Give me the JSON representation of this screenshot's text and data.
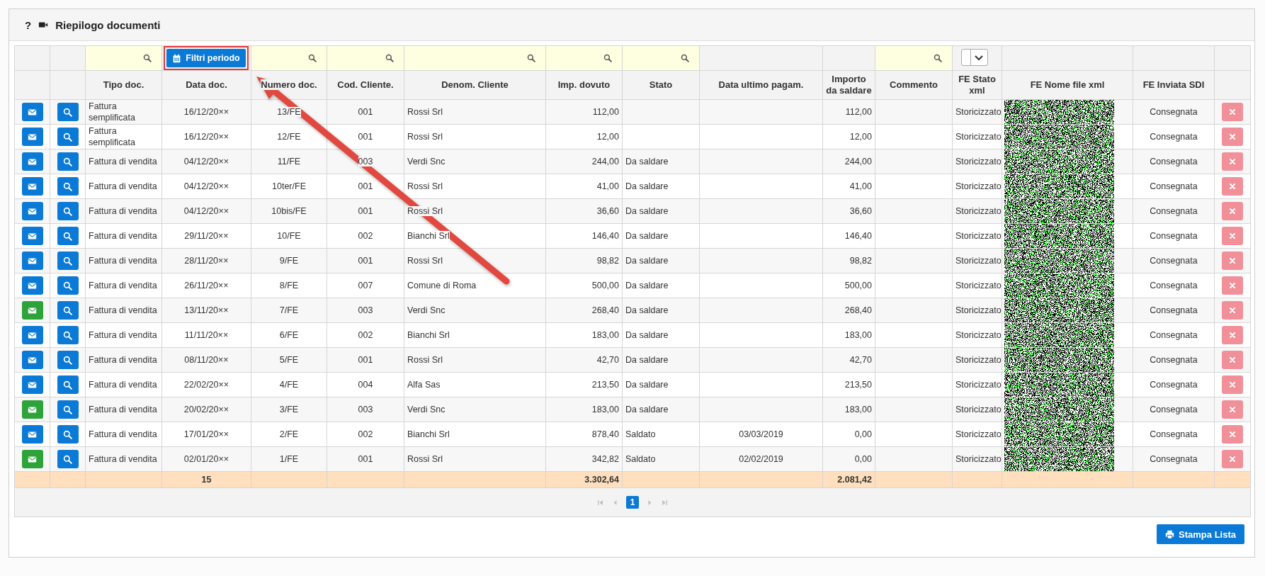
{
  "panel": {
    "help": "?",
    "title": "Riepilogo documenti"
  },
  "columns": [
    {
      "label": "Tipo doc.",
      "kind": "search"
    },
    {
      "label": "Data doc.",
      "kind": "period",
      "button": "Filtri periodo"
    },
    {
      "label": "Numero doc.",
      "kind": "search"
    },
    {
      "label": "Cod. Cliente.",
      "kind": "search"
    },
    {
      "label": "Denom. Cliente",
      "kind": "search"
    },
    {
      "label": "Imp. dovuto",
      "kind": "search"
    },
    {
      "label": "Stato",
      "kind": "search"
    },
    {
      "label": "Data ultimo pagam.",
      "kind": "plain"
    },
    {
      "label": "Importo da saldare",
      "kind": "plain"
    },
    {
      "label": "Commento",
      "kind": "search"
    },
    {
      "label": "FE Stato xml",
      "kind": "select"
    },
    {
      "label": "FE Nome file xml",
      "kind": "plain"
    },
    {
      "label": "FE Inviata SDI",
      "kind": "plain"
    }
  ],
  "rows": [
    {
      "mail_button": {
        "color": "#0b7ad6"
      },
      "type": "Fattura semplificata",
      "date": "16/12/20××",
      "number": "13/FE",
      "customer_code": "001",
      "customer": "Rossi Srl",
      "amount_due": "112,00",
      "balance": "112,00",
      "fe_status": "Storicizzato",
      "fe_sent": "Consegnata"
    },
    {
      "mail_button": {
        "color": "#0b7ad6"
      },
      "type": "Fattura semplificata",
      "date": "16/12/20××",
      "number": "12/FE",
      "customer_code": "001",
      "customer": "Rossi Srl",
      "amount_due": "12,00",
      "balance": "12,00",
      "fe_status": "Storicizzato",
      "fe_sent": "Consegnata"
    },
    {
      "mail_button": {
        "color": "#0b7ad6"
      },
      "type": "Fattura di vendita",
      "date": "04/12/20××",
      "number": "11/FE",
      "customer_code": "003",
      "customer": "Verdi Snc",
      "amount_due": "244,00",
      "status": "Da saldare",
      "balance": "244,00",
      "fe_status": "Storicizzato",
      "fe_sent": "Consegnata"
    },
    {
      "mail_button": {
        "color": "#0b7ad6"
      },
      "type": "Fattura di vendita",
      "date": "04/12/20××",
      "number": "10ter/FE",
      "customer_code": "001",
      "customer": "Rossi Srl",
      "amount_due": "41,00",
      "status": "Da saldare",
      "balance": "41,00",
      "fe_status": "Storicizzato",
      "fe_sent": "Consegnata"
    },
    {
      "mail_button": {
        "color": "#0b7ad6"
      },
      "type": "Fattura di vendita",
      "date": "04/12/20××",
      "number": "10bis/FE",
      "customer_code": "001",
      "customer": "Rossi Srl",
      "amount_due": "36,60",
      "status": "Da saldare",
      "balance": "36,60",
      "fe_status": "Storicizzato",
      "fe_sent": "Consegnata"
    },
    {
      "mail_button": {
        "color": "#0b7ad6"
      },
      "type": "Fattura di vendita",
      "date": "29/11/20××",
      "number": "10/FE",
      "customer_code": "002",
      "customer": "Bianchi Srl",
      "amount_due": "146,40",
      "status": "Da saldare",
      "balance": "146,40",
      "fe_status": "Storicizzato",
      "fe_sent": "Consegnata"
    },
    {
      "mail_button": {
        "color": "#0b7ad6"
      },
      "type": "Fattura di vendita",
      "date": "28/11/20××",
      "number": "9/FE",
      "customer_code": "001",
      "customer": "Rossi Srl",
      "amount_due": "98,82",
      "status": "Da saldare",
      "balance": "98,82",
      "fe_status": "Storicizzato",
      "fe_sent": "Consegnata"
    },
    {
      "mail_button": {
        "color": "#0b7ad6"
      },
      "type": "Fattura di vendita",
      "date": "26/11/20××",
      "number": "8/FE",
      "customer_code": "007",
      "customer": "Comune di Roma",
      "amount_due": "500,00",
      "status": "Da saldare",
      "balance": "500,00",
      "fe_status": "Storicizzato",
      "fe_sent": "Consegnata"
    },
    {
      "mail_button": {
        "color": "#2ea33a"
      },
      "type": "Fattura di vendita",
      "date": "13/11/20××",
      "number": "7/FE",
      "customer_code": "003",
      "customer": "Verdi Snc",
      "amount_due": "268,40",
      "status": "Da saldare",
      "balance": "268,40",
      "fe_status": "Storicizzato",
      "fe_sent": "Consegnata"
    },
    {
      "mail_button": {
        "color": "#0b7ad6"
      },
      "type": "Fattura di vendita",
      "date": "11/11/20××",
      "number": "6/FE",
      "customer_code": "002",
      "customer": "Bianchi Srl",
      "amount_due": "183,00",
      "status": "Da saldare",
      "balance": "183,00",
      "fe_status": "Storicizzato",
      "fe_sent": "Consegnata"
    },
    {
      "mail_button": {
        "color": "#0b7ad6"
      },
      "type": "Fattura di vendita",
      "date": "08/11/20××",
      "number": "5/FE",
      "customer_code": "001",
      "customer": "Rossi Srl",
      "amount_due": "42,70",
      "status": "Da saldare",
      "balance": "42,70",
      "fe_status": "Storicizzato",
      "fe_sent": "Consegnata"
    },
    {
      "mail_button": {
        "color": "#0b7ad6"
      },
      "type": "Fattura di vendita",
      "date": "22/02/20××",
      "number": "4/FE",
      "customer_code": "004",
      "customer": "Alfa Sas",
      "amount_due": "213,50",
      "status": "Da saldare",
      "balance": "213,50",
      "fe_status": "Storicizzato",
      "fe_sent": "Consegnata"
    },
    {
      "mail_button": {
        "color": "#2ea33a"
      },
      "type": "Fattura di vendita",
      "date": "20/02/20××",
      "number": "3/FE",
      "customer_code": "003",
      "customer": "Verdi Snc",
      "amount_due": "183,00",
      "status": "Da saldare",
      "balance": "183,00",
      "fe_status": "Storicizzato",
      "fe_sent": "Consegnata"
    },
    {
      "mail_button": {
        "color": "#0b7ad6"
      },
      "type": "Fattura di vendita",
      "date": "17/01/20××",
      "number": "2/FE",
      "customer_code": "002",
      "customer": "Bianchi Srl",
      "amount_due": "878,40",
      "status": "Saldato",
      "last_payment": "03/03/2019",
      "balance": "0,00",
      "fe_status": "Storicizzato",
      "fe_sent": "Consegnata"
    },
    {
      "mail_button": {
        "color": "#2ea33a"
      },
      "type": "Fattura di vendita",
      "date": "02/01/20××",
      "number": "1/FE",
      "customer_code": "001",
      "customer": "Rossi Srl",
      "amount_due": "342,82",
      "status": "Saldato",
      "last_payment": "02/02/2019",
      "balance": "0,00",
      "fe_status": "Storicizzato",
      "fe_sent": "Consegnata"
    }
  ],
  "totals": {
    "count": "15",
    "amount_due": "3.302,64",
    "balance": "2.081,42"
  },
  "pager": {
    "page": "1"
  },
  "print_button": "Stampa Lista"
}
